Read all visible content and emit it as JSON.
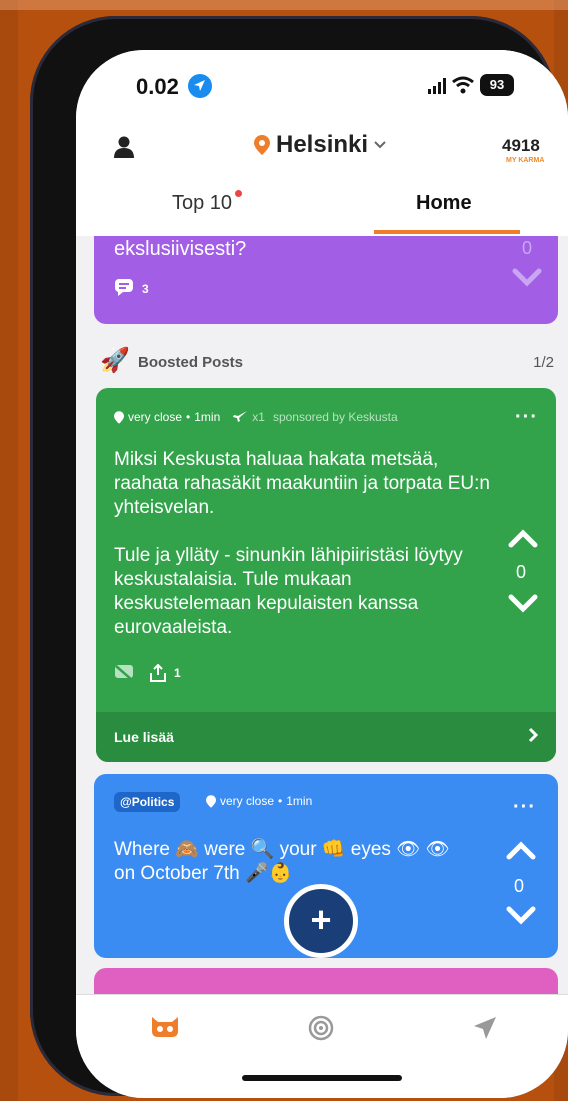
{
  "status_bar": {
    "time": "0.02",
    "battery": "93"
  },
  "header": {
    "city": "Helsinki",
    "karma_value": "4918",
    "karma_label": "MY KARMA"
  },
  "tabs": [
    {
      "label": "Top 10"
    },
    {
      "label": "Home"
    }
  ],
  "purple_post": {
    "text": "ekslusiivisesti?",
    "comments": "3",
    "votes": "0"
  },
  "boosted": {
    "label": "Boosted Posts",
    "page": "1/2"
  },
  "green_post": {
    "distance": "very close",
    "age": "1min",
    "boost": "x1",
    "sponsor": "sponsored by Keskusta",
    "body": "Miksi Keskusta haluaa hakata metsää, raahata rahasäkit maakuntiin ja torpata EU:n yhteisvelan.\n\nTule ja ylläty - sinunkin lähipiiristäsi löytyy keskustalaisia. Tule mukaan keskustelemaan kepulaisten kanssa eurovaaleista.",
    "votes": "0",
    "shares": "1",
    "read_more": "Lue lisää"
  },
  "blue_post": {
    "tag": "@Politics",
    "distance": "very close",
    "age": "1min",
    "body": "Where 🙈 were 🔍 your 👊 eyes 👁 👁 on October 7th 🎤👶",
    "votes": "0"
  },
  "icons": {
    "accent": "#f07d2a",
    "fab_color": "#1a3e78"
  }
}
